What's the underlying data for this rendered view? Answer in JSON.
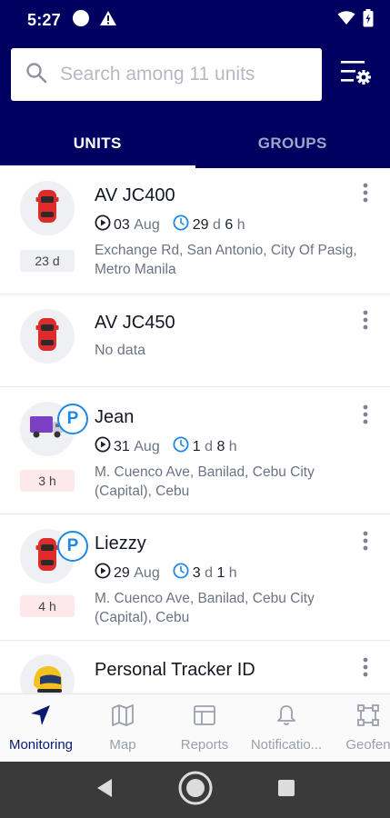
{
  "status_bar": {
    "time": "5:27"
  },
  "search": {
    "placeholder": "Search among 11 units"
  },
  "tabs": [
    {
      "label": "UNITS",
      "active": true
    },
    {
      "label": "GROUPS",
      "active": false
    }
  ],
  "units": [
    {
      "name": "AV JC400",
      "icon": "red-car-icon",
      "parked": false,
      "date_day": "03",
      "date_month": "Aug",
      "dur_a_num": "29",
      "dur_a_unit": "d",
      "dur_b_num": "6",
      "dur_b_unit": "h",
      "address": "Exchange Rd, San Antonio, City Of Pasig, Metro Manila",
      "age": "23 d",
      "age_style": "grey"
    },
    {
      "name": "AV JC450",
      "icon": "red-car-icon",
      "parked": false,
      "status_text": "No data"
    },
    {
      "name": "Jean",
      "icon": "purple-truck-icon",
      "parked": true,
      "badge": "P",
      "date_day": "31",
      "date_month": "Aug",
      "dur_a_num": "1",
      "dur_a_unit": "d",
      "dur_b_num": "8",
      "dur_b_unit": "h",
      "address": "M. Cuenco Ave, Banilad, Cebu City (Capital), Cebu",
      "age": "3 h",
      "age_style": "red"
    },
    {
      "name": "Liezzy",
      "icon": "red-car-icon",
      "parked": true,
      "badge": "P",
      "date_day": "29",
      "date_month": "Aug",
      "dur_a_num": "3",
      "dur_a_unit": "d",
      "dur_b_num": "1",
      "dur_b_unit": "h",
      "address": "M. Cuenco Ave, Banilad, Cebu City (Capital), Cebu",
      "age": "4 h",
      "age_style": "red"
    },
    {
      "name": "Personal Tracker ID",
      "icon": "helmet-icon",
      "parked": false
    }
  ],
  "bottom_nav": [
    {
      "label": "Monitoring",
      "icon": "navigation-arrow-icon",
      "active": true
    },
    {
      "label": "Map",
      "icon": "map-icon",
      "active": false
    },
    {
      "label": "Reports",
      "icon": "reports-icon",
      "active": false
    },
    {
      "label": "Notificatio...",
      "icon": "bell-icon",
      "active": false
    },
    {
      "label": "Geofen",
      "icon": "geofence-icon",
      "active": false
    }
  ],
  "colors": {
    "header_bg": "#000060",
    "accent": "#1e88e5",
    "nav_active": "#0a1a72",
    "muted_text": "#6c7382"
  }
}
